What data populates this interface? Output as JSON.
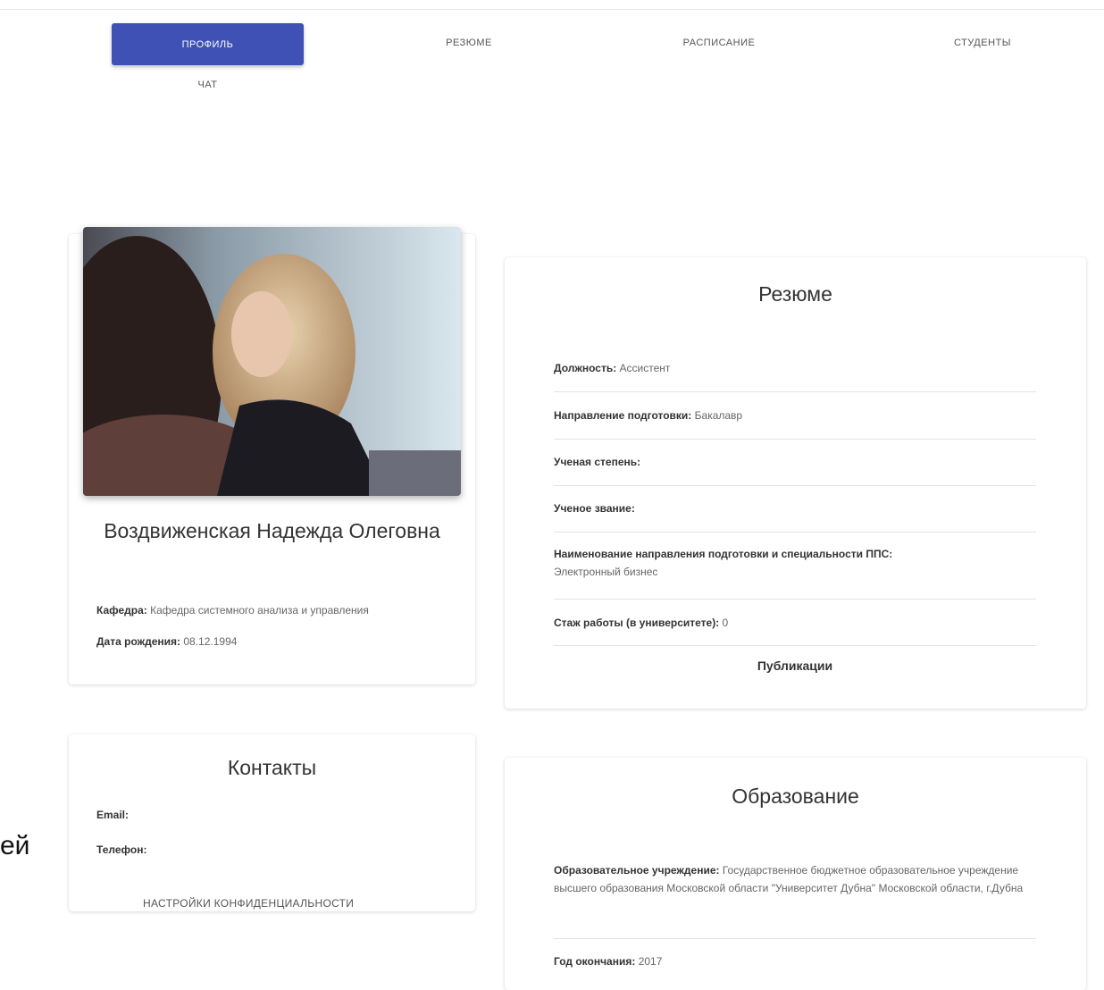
{
  "nav": {
    "tabs": [
      {
        "label": "Профиль",
        "active": true
      },
      {
        "label": "Резюме",
        "active": false
      },
      {
        "label": "Расписание",
        "active": false
      },
      {
        "label": "Студенты",
        "active": false
      },
      {
        "label": "Чат",
        "active": false
      }
    ]
  },
  "profile": {
    "name": "Воздвиженская Надежда Олеговна",
    "department_label": "Кафедра:",
    "department_value": "Кафедра системного анализа и управления",
    "birth_label": "Дата рождения:",
    "birth_value": "08.12.1994"
  },
  "contacts": {
    "title": "Контакты",
    "email_label": "Email:",
    "phone_label": "Телефон:",
    "privacy_button": "Настройки конфиденциальности"
  },
  "resume": {
    "title": "Резюме",
    "fields": [
      {
        "label": "Должность:",
        "value": "Ассистент"
      },
      {
        "label": "Направление подготовки:",
        "value": "Бакалавр"
      },
      {
        "label": "Ученая степень:",
        "value": ""
      },
      {
        "label": "Ученое звание:",
        "value": ""
      },
      {
        "label": "Наименование направления подготовки и специальности ППС:",
        "value": "Электронный бизнес"
      },
      {
        "label": "Стаж работы (в университете):",
        "value": "0"
      }
    ],
    "publications": "Публикации"
  },
  "education": {
    "title": "Образование",
    "institution_label": "Образовательное учреждение:",
    "institution_value": "Государственное бюджетное образовательное учреждение высшего образования Московской области \"Университет Дубна\" Московской области, г.Дубна",
    "year_label": "Год окончания:",
    "year_value": "2017"
  },
  "stray_text": "ей",
  "colors": {
    "accent": "#3f51b5"
  }
}
